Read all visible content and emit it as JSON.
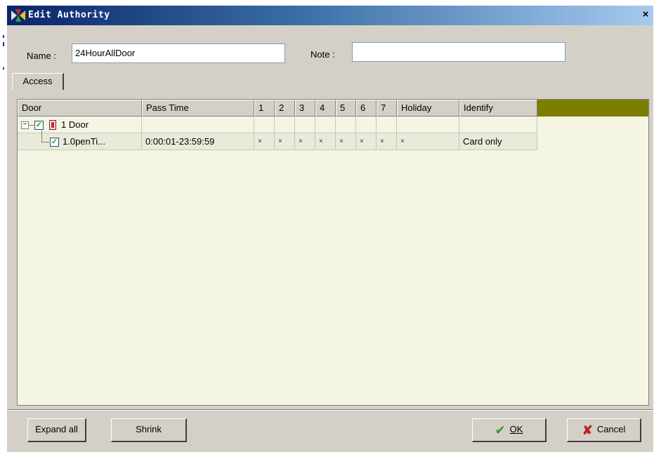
{
  "window": {
    "title": "Edit Authority",
    "close_glyph": "×"
  },
  "form": {
    "name_label": "Name :",
    "name_value": "24HourAllDoor",
    "note_label": "Note :",
    "note_value": ""
  },
  "tabs": [
    {
      "label": "Access"
    }
  ],
  "grid": {
    "columns": [
      "Door",
      "Pass Time",
      "1",
      "2",
      "3",
      "4",
      "5",
      "6",
      "7",
      "Holiday",
      "Identify"
    ],
    "rows": [
      {
        "expander": "−",
        "checked": true,
        "icon": "door-icon",
        "door": "1 Door",
        "pass_time": "",
        "days": [
          "",
          "",
          "",
          "",
          "",
          "",
          ""
        ],
        "holiday": "",
        "identify": ""
      },
      {
        "checked": true,
        "door": "1.0penTi...",
        "pass_time": "0:00:01-23:59:59",
        "days": [
          "×",
          "×",
          "×",
          "×",
          "×",
          "×",
          "×"
        ],
        "holiday": "×",
        "identify": "Card only"
      }
    ]
  },
  "buttons": {
    "expand_all": "Expand all",
    "shrink": "Shrink",
    "ok": "OK",
    "cancel": "Cancel"
  },
  "colors": {
    "titlebar": "#0a246a",
    "dialog": "#d4d0c8",
    "grid_bg": "#f5f5e4",
    "header_fill": "#7d7d00"
  }
}
